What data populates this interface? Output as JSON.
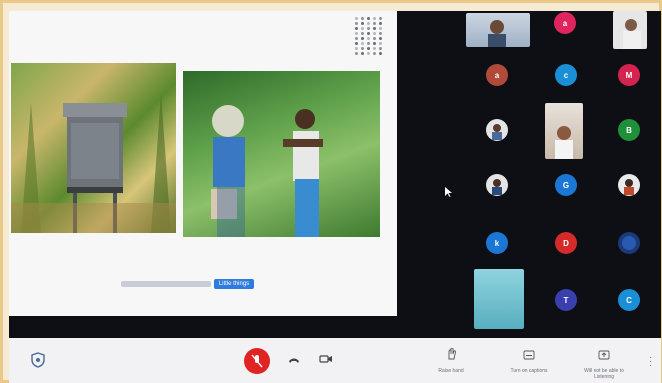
{
  "meeting": {
    "shared_slide": {
      "footer_button_label": "Little things"
    },
    "participants": [
      {
        "initial": "a",
        "color": "#e0245e"
      },
      {
        "initial": "a",
        "color": "#b24a3a"
      },
      {
        "initial": "c",
        "color": "#1b8fd6"
      },
      {
        "initial": "M",
        "color": "#d4234f"
      },
      {
        "initial": "B",
        "color": "#1f8f3a"
      },
      {
        "initial": "G",
        "color": "#1a78d4"
      },
      {
        "initial": "k",
        "color": "#1a78d4"
      },
      {
        "initial": "D",
        "color": "#d42a2a"
      },
      {
        "initial": "T",
        "color": "#3a3fb0"
      },
      {
        "initial": "C",
        "color": "#1b8fd6"
      }
    ]
  },
  "toolbar": {
    "raise_hand_label": "Raise hand",
    "turn_on_captions_label": "Turn on captions",
    "present_label_1": "Will not be able to",
    "present_label_2": "Listening"
  }
}
